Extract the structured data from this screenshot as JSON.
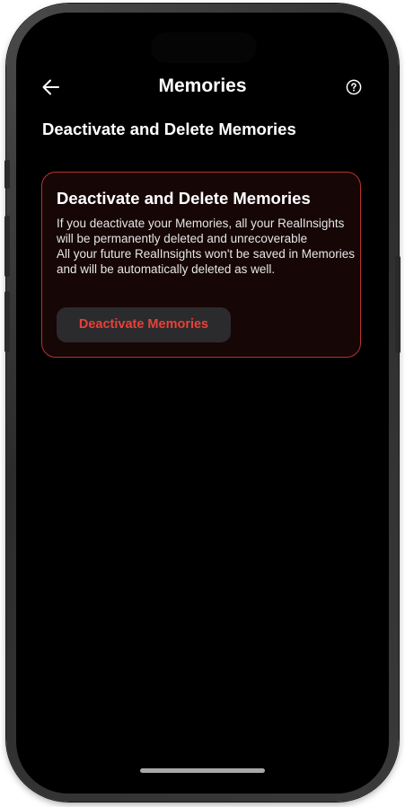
{
  "header": {
    "title": "Memories",
    "back_icon": "arrow-left-icon",
    "help_icon": "question-circle-icon"
  },
  "main": {
    "section_heading": "Deactivate and Delete Memories",
    "card": {
      "title": "Deactivate and Delete Memories",
      "description_line1": "If you deactivate your Memories, all your RealInsights will be permanently deleted and unrecoverable",
      "description_line2": "All your future RealInsights won't be saved in Memories and will be automatically deleted as well.",
      "button_label": "Deactivate Memories"
    }
  },
  "colors": {
    "background": "#000000",
    "accent_red": "#e8403a",
    "card_border": "#b8322e",
    "card_background": "#160606",
    "button_background": "#2b2b2d"
  }
}
